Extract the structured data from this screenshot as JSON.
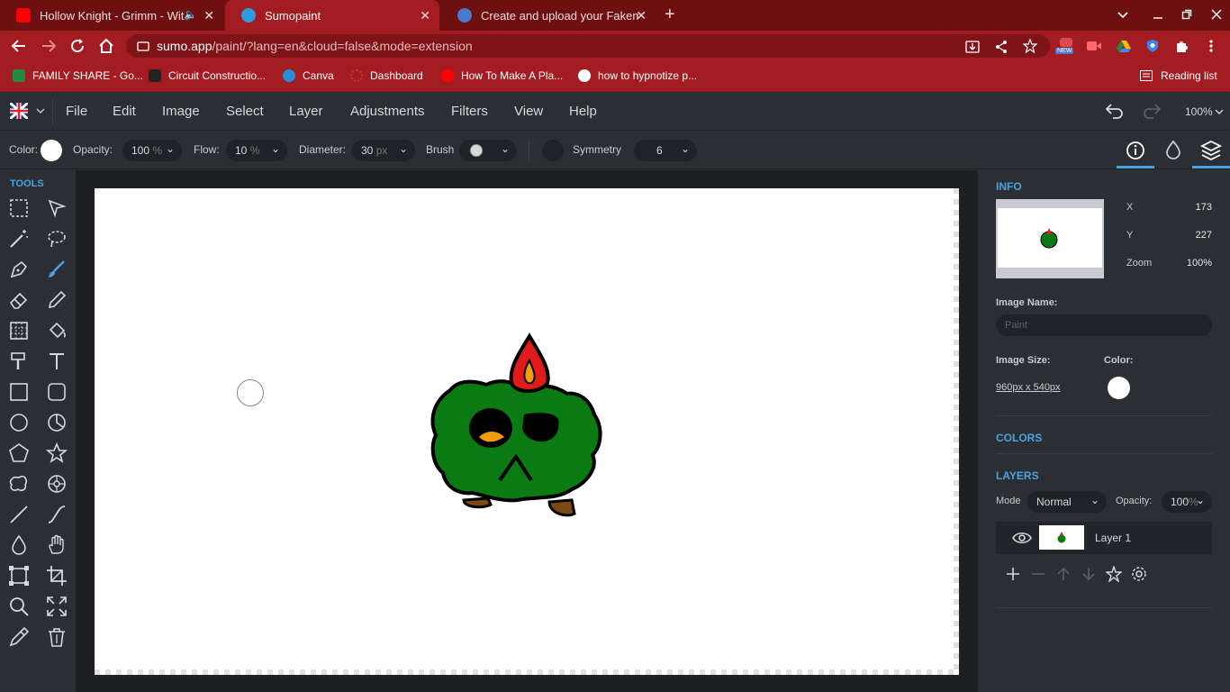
{
  "browser": {
    "tabs": [
      {
        "title": "Hollow Knight - Grimm - Wit",
        "favicon_color": "#ff0000",
        "active": false
      },
      {
        "title": "Sumopaint",
        "favicon_color": "#2d9cdb",
        "active": true
      },
      {
        "title": "Create and upload your Fakemo",
        "favicon_color": "#4a7bd0",
        "active": false
      }
    ],
    "close_glyph": "✕",
    "new_tab_glyph": "+",
    "url_host": "sumo.app",
    "url_path": "/paint/?lang=en&cloud=false&mode=extension",
    "new_badge": "NEW",
    "bookmarks": [
      {
        "label": "FAMILY SHARE - Go...",
        "color": "#1e8e3e"
      },
      {
        "label": "Circuit Constructio...",
        "color": "#222222"
      },
      {
        "label": "Canva",
        "color": "#2a8bd6"
      },
      {
        "label": "Dashboard",
        "color": "#d93025"
      },
      {
        "label": "How To Make A Pla...",
        "color": "#ff0000"
      },
      {
        "label": "how to hypnotize p...",
        "color": "#ffffff"
      }
    ],
    "reading_list": "Reading list"
  },
  "app": {
    "menu": [
      "File",
      "Edit",
      "Image",
      "Select",
      "Layer",
      "Adjustments",
      "Filters",
      "View",
      "Help"
    ],
    "zoom": "100%",
    "options": {
      "color_label": "Color:",
      "opacity_label": "Opacity:",
      "opacity_value": "100",
      "opacity_unit": "%",
      "flow_label": "Flow:",
      "flow_value": "10",
      "flow_unit": "%",
      "diameter_label": "Diameter:",
      "diameter_value": "30",
      "diameter_unit": "px",
      "brush_label": "Brush",
      "symmetry_label": "Symmetry",
      "symmetry_value": "6"
    },
    "tools_label": "TOOLS",
    "info": {
      "title": "INFO",
      "x_label": "X",
      "x_value": "173",
      "y_label": "Y",
      "y_value": "227",
      "zoom_label": "Zoom",
      "zoom_value": "100%",
      "image_name_label": "Image Name:",
      "image_name_placeholder": "Paint",
      "image_size_label": "Image Size:",
      "image_size_value": "960px x 540px",
      "color_label": "Color:"
    },
    "colors_title": "COLORS",
    "layers": {
      "title": "LAYERS",
      "mode_label": "Mode",
      "mode_value": "Normal",
      "opacity_label": "Opacity:",
      "opacity_value": "100",
      "opacity_unit": "%",
      "layer_name": "Layer 1"
    },
    "accent_color": "#4aa3df"
  }
}
